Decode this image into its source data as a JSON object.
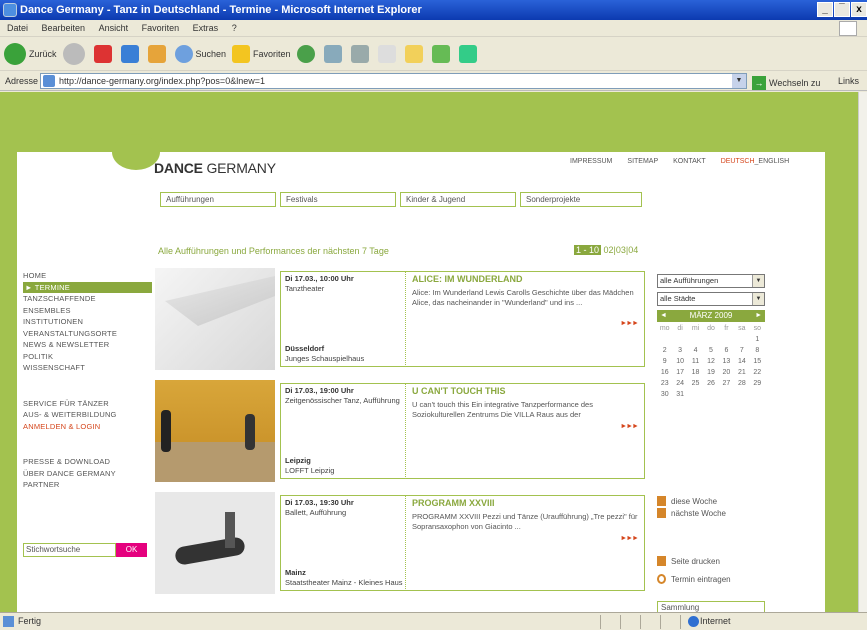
{
  "window": {
    "title": "Dance Germany - Tanz in Deutschland - Termine - Microsoft Internet Explorer",
    "controls": [
      "_",
      "̅",
      "x"
    ]
  },
  "menu": [
    "Datei",
    "Bearbeiten",
    "Ansicht",
    "Favoriten",
    "Extras",
    "?"
  ],
  "toolbar": {
    "back": "Zurück",
    "search": "Suchen",
    "favorites": "Favoriten"
  },
  "address": {
    "label": "Adresse",
    "url": "http://dance-germany.org/index.php?pos=0&lnew=1",
    "go": "Wechseln zu",
    "links": "Links"
  },
  "status": {
    "text": "Fertig",
    "zone": "Internet"
  },
  "site": {
    "logo_a": "DANCE",
    "logo_b": " GERMANY",
    "toplinks": [
      "IMPRESSUM",
      "SITEMAP",
      "KONTAKT"
    ],
    "lang_active": "DEUTSCH",
    "lang_other": "_ENGLISH",
    "tabs": [
      "Aufführungen",
      "Festivals",
      "Kinder & Jugend",
      "Sonderprojekte"
    ],
    "heading": "Alle Aufführungen und Performances der nächsten 7 Tage",
    "pager": {
      "current": "1 - 10",
      "others": "02|03|04"
    },
    "nav": {
      "group1": [
        "HOME",
        "► TERMINE",
        "TANZSCHAFFENDE",
        "ENSEMBLES",
        "INSTITUTIONEN",
        "VERANSTALTUNGSORTE",
        "NEWS & NEWSLETTER",
        "POLITIK",
        "WISSENSCHAFT"
      ],
      "group2": [
        "SERVICE FÜR TÄNZER",
        "AUS- & WEITERBILDUNG",
        "ANMELDEN & LOGIN"
      ],
      "group3": [
        "PRESSE & DOWNLOAD",
        "ÜBER DANCE GERMANY",
        "PARTNER"
      ]
    },
    "search_placeholder": "Stichwortsuche",
    "search_button": "OK",
    "events": [
      {
        "date": "Di 17.03., 10:00 Uhr",
        "genre": "Tanztheater",
        "city": "Düsseldorf",
        "venue": "Junges Schauspielhaus",
        "title": "ALICE: IM WUNDERLAND",
        "desc": "Alice: Im Wunderland Lewis Carolls Geschichte über das Mädchen Alice, das nacheinander in \"Wunderland\" und ins ...",
        "more": "►►►"
      },
      {
        "date": "Di 17.03., 19:00 Uhr",
        "genre": "Zeitgenössischer Tanz, Aufführung",
        "city": "Leipzig",
        "venue": "LOFFT Leipzig",
        "title": "U CAN'T TOUCH THIS",
        "desc": "U can't touch this Ein integrative Tanzperformance des Soziokulturellen Zentrums Die VILLA Raus aus der",
        "more": "►►►"
      },
      {
        "date": "Di 17.03., 19:30 Uhr",
        "genre": "Ballett, Aufführung",
        "city": "Mainz",
        "venue": "Staatstheater Mainz - Kleines Haus",
        "title": "PROGRAMM XXVIII",
        "desc": "PROGRAMM XXVIII Pezzi und Tänze (Uraufführung) „Tre pezzi\" für Sopransaxophon von Giacinto ...",
        "more": "►►►"
      }
    ],
    "filters": {
      "type": "alle Aufführungen",
      "city": "alle Städte"
    },
    "calendar": {
      "month": "MÄRZ 2009",
      "prev": "◄",
      "next": "►",
      "daynames": [
        "mo",
        "di",
        "mi",
        "do",
        "fr",
        "sa",
        "so"
      ],
      "days": [
        "",
        "",
        "",
        "",
        "",
        "",
        "1",
        "2",
        "3",
        "4",
        "5",
        "6",
        "7",
        "8",
        "9",
        "10",
        "11",
        "12",
        "13",
        "14",
        "15",
        "16",
        "17",
        "18",
        "19",
        "20",
        "21",
        "22",
        "23",
        "24",
        "25",
        "26",
        "27",
        "28",
        "29",
        "30",
        "31",
        "",
        "",
        "",
        "",
        ""
      ]
    },
    "week_links": [
      "diese Woche",
      "nächste Woche"
    ],
    "actions": [
      "Seite drucken",
      "Termin eintragen"
    ],
    "collection": "Sammlung"
  }
}
